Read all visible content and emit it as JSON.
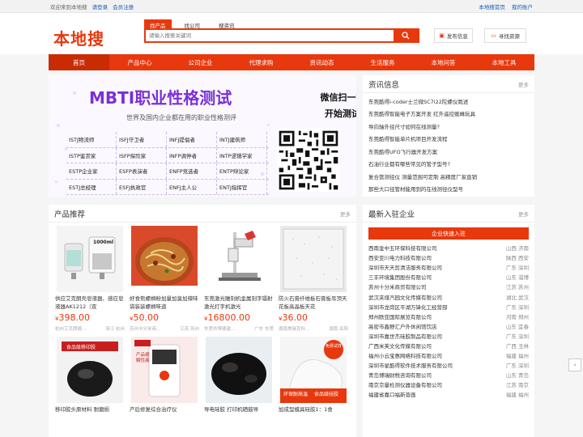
{
  "topbar": {
    "welcome": "欢迎来到本地搜",
    "login": "请登录",
    "register": "会员注册",
    "home": "本地搜首页",
    "account": "我的账户"
  },
  "header": {
    "logo": "本地搜",
    "tabs": [
      "找产品",
      "找公司",
      "搜资讯"
    ],
    "search_placeholder": "请输入搜索关键词",
    "publish": "发布信息",
    "find_resource": "寻找资源"
  },
  "nav": [
    "首页",
    "产品中心",
    "公司企业",
    "代理求购",
    "资讯动态",
    "生活服务",
    "本地问答",
    "本地工具"
  ],
  "banner": {
    "title": "MBTI职业性格测试",
    "subtitle": "世界及国内企业都在用的职业性格测评",
    "scan1": "微信扫一扫",
    "scan2": "开始测试",
    "grid": [
      [
        "ISTJ物流师",
        "ISFJ守卫者",
        "INFJ提倡者",
        "INTJ建筑师"
      ],
      [
        "ISTP鉴赏家",
        "ISFP探险家",
        "INFP调停者",
        "INTP逻辑学家"
      ],
      [
        "ESTP企业家",
        "ESFP表演者",
        "ENFP竞选者",
        "ENTP辩论家"
      ],
      [
        "ESTJ总经理",
        "ESFJ执政官",
        "ENFJ主人公",
        "ENTJ指挥官"
      ]
    ]
  },
  "news": {
    "title": "资讯信息",
    "more": "更多",
    "items": [
      "东莞酷得i-coder士兰微SC7i22陀螺仪氮述",
      "东莞酷得智能电子方案开发 红外遥控蜘蛛玩具",
      "导向轴外径尺寸如何在线测量?",
      "东莞酷得智能单片机项目开发流程",
      "东莞酷得UFO飞行器开发方案",
      "石油行业都有哪些常见的管子型号?",
      "复合管测径仪 测量范围可定制 高精度厂家直销",
      "那些大口径管材能用到的在线测径仪型号"
    ]
  },
  "products": {
    "title": "产品推荐",
    "more": "更多",
    "items": [
      {
        "name": "供应艾克朗壳皂液器、感应皂液器AK1212（双",
        "price": "398.00",
        "loc": "杭州艾克朗德...",
        "region": "浙江 杭州"
      },
      {
        "name": "好食熊螺蛳粉加量加臭加辣味袋装装螺蛳味道",
        "price": "50.00",
        "loc": "苏州卡分米商...",
        "region": "江苏 苏州"
      },
      {
        "name": "东莞激光雕刻机金属刻字镭射激光打字机激光",
        "price": "16800.00",
        "loc": "东莞市博德激...",
        "region": "广东 东莞"
      },
      {
        "name": "防火石膏纤维板石膏板吊顶天花板高晶板天花",
        "price": "36.00",
        "loc": "湖南美瑞克科...",
        "region": "湖南 岳阳"
      },
      {
        "name": "移印胶头原材料 耐磨损",
        "price": "",
        "loc": "",
        "region": ""
      },
      {
        "name": "产后修复综合治疗仪",
        "price": "",
        "loc": "",
        "region": ""
      },
      {
        "name": "导电硅胶 打印机硒鼓导",
        "price": "",
        "loc": "",
        "region": ""
      },
      {
        "name": "加成型模具硅胶1：1食",
        "price": "",
        "loc": "",
        "region": ""
      }
    ],
    "img_texts": {
      "dispenser": "1000ml",
      "pad": "食品级移印胶",
      "machine": "产品缓解性痛",
      "silicone": "环保耐高温",
      "silicone2": "食品级硅胶",
      "sample": "免费试样"
    }
  },
  "companies": {
    "title": "最新入驻企业",
    "more": "更多",
    "join": "企业快速入驻",
    "items": [
      {
        "name": "西南金中五环保科技有限公司",
        "loc": "山西 济南"
      },
      {
        "name": "西安亚川电力科技有限公司",
        "loc": "陕西 西安"
      },
      {
        "name": "深圳市天天剪清洁服务有限公司",
        "loc": "广东 深圳"
      },
      {
        "name": "三丰环境集团股份有限公司",
        "loc": "山东 淄博"
      },
      {
        "name": "苏州十分米商贸有限公司",
        "loc": "江苏 苏州"
      },
      {
        "name": "武汉夹煤汽园文化传媒有限公司",
        "loc": "湖北 武汉"
      },
      {
        "name": "深圳市龙岗区平湖万锋化工经营部",
        "loc": "广东 深圳"
      },
      {
        "name": "郑州欧亚国际展览有限公司",
        "loc": "河南 郑州"
      },
      {
        "name": "高密市鑫野汇户外休闲馆饮店",
        "loc": "山东 宜春"
      },
      {
        "name": "深圳市嘉世杰硅胶制品有限公司",
        "loc": "广东 深圳"
      },
      {
        "name": "广西米芙文化传媒有限公司",
        "loc": "广西 玉林"
      },
      {
        "name": "福州小云宝惠网络科技有限公司",
        "loc": "福建 福州"
      },
      {
        "name": "深圳市星酷得软件技术服务有限公司",
        "loc": "广东 深圳"
      },
      {
        "name": "青岛博瑞财税咨询有限公司",
        "loc": "山东 青岛"
      },
      {
        "name": "南京京量检测仪器设备有限公司",
        "loc": "江苏 南京"
      },
      {
        "name": "福建省嘉口福新普画",
        "loc": "福建 福州"
      }
    ]
  },
  "colors": {
    "accent": "#e8380d",
    "purple": "#7b2fd6"
  }
}
